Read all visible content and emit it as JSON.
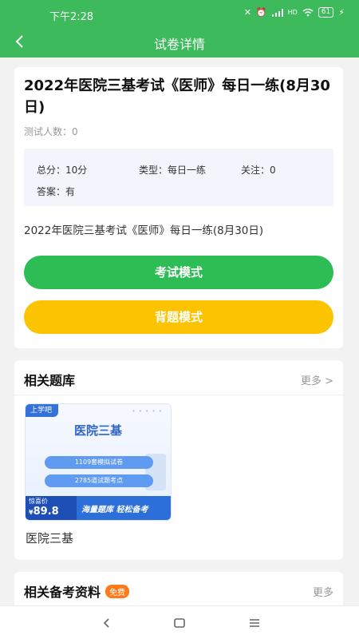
{
  "status_bar": {
    "time": "下午2:28",
    "signal": "HD",
    "battery": "61"
  },
  "nav": {
    "title": "试卷详情"
  },
  "exam": {
    "title": "2022年医院三基考试《医师》每日一练(8月30日)",
    "testers": "测试人数：0",
    "total_score": "总分：10分",
    "type": "类型：每日一练",
    "follow": "关注：0",
    "answer": "答案：有",
    "description": "2022年医院三基考试《医师》每日一练(8月30日)"
  },
  "buttons": {
    "exam_mode": "考试模式",
    "review_mode": "背题模式"
  },
  "related_bank": {
    "title": "相关题库",
    "more": "更多 >",
    "item": {
      "brand": "上学吧",
      "cover_title": "医院三基",
      "pill1": "1109套模拟试卷",
      "pill2": "2785道试题考点",
      "price_label": "惊喜价",
      "currency": "¥",
      "price": "89.8",
      "slogan": "海量题库  轻松备考",
      "name": "医院三基"
    }
  },
  "related_materials": {
    "title": "相关备考资料",
    "badge": "免费",
    "more": "更多"
  },
  "colors": {
    "primary": "#3dba5b",
    "button_green": "#2ebc55",
    "button_yellow": "#fcc300",
    "badge": "#ff7a1a"
  }
}
